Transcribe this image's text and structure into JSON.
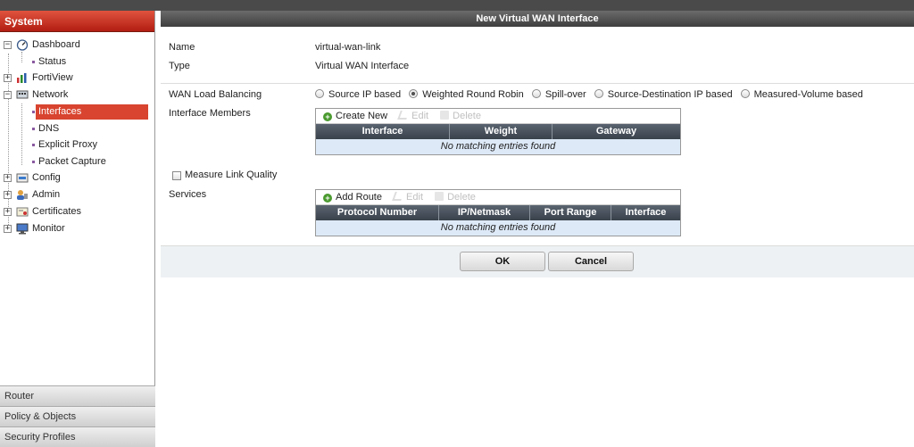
{
  "sidebar": {
    "header": "System",
    "items": [
      {
        "label": "Dashboard",
        "icon": "dashboard-icon",
        "expander": "⊟"
      },
      {
        "label": "Status"
      },
      {
        "label": "FortiView",
        "icon": "fortiview-icon",
        "expander": "⊞"
      },
      {
        "label": "Network",
        "icon": "network-icon",
        "expander": "⊟"
      },
      {
        "label": "Interfaces",
        "selected": true
      },
      {
        "label": "DNS"
      },
      {
        "label": "Explicit Proxy"
      },
      {
        "label": "Packet Capture"
      },
      {
        "label": "Config",
        "icon": "config-icon",
        "expander": "⊞"
      },
      {
        "label": "Admin",
        "icon": "admin-icon",
        "expander": "⊞"
      },
      {
        "label": "Certificates",
        "icon": "certificates-icon",
        "expander": "⊞"
      },
      {
        "label": "Monitor",
        "icon": "monitor-icon",
        "expander": "⊞"
      }
    ],
    "bottom_sections": [
      "Router",
      "Policy & Objects",
      "Security Profiles"
    ]
  },
  "panel": {
    "title": "New Virtual WAN Interface",
    "fields": {
      "name_label": "Name",
      "name_value": "virtual-wan-link",
      "type_label": "Type",
      "type_value": "Virtual WAN Interface",
      "wan_lb_label": "WAN Load Balancing",
      "members_label": "Interface Members",
      "measure_label": "Measure Link Quality",
      "services_label": "Services"
    },
    "wan_lb_options": [
      {
        "label": "Source IP based",
        "checked": false
      },
      {
        "label": "Weighted Round Robin",
        "checked": true
      },
      {
        "label": "Spill-over",
        "checked": false
      },
      {
        "label": "Source-Destination IP based",
        "checked": false
      },
      {
        "label": "Measured-Volume based",
        "checked": false
      }
    ],
    "members_grid": {
      "toolbar": {
        "create": "Create New",
        "edit": "Edit",
        "delete": "Delete"
      },
      "columns": [
        "Interface",
        "Weight",
        "Gateway"
      ],
      "empty": "No matching entries found"
    },
    "services_grid": {
      "toolbar": {
        "add": "Add Route",
        "edit": "Edit",
        "delete": "Delete"
      },
      "columns": [
        "Protocol Number",
        "IP/Netmask",
        "Port Range",
        "Interface"
      ],
      "empty": "No matching entries found"
    },
    "buttons": {
      "ok": "OK",
      "cancel": "Cancel"
    }
  },
  "colors": {
    "accent": "#d8442f",
    "header_dark": "#3e3e3e",
    "grid_header": "#39414b",
    "grid_empty_bg": "#dde9f7"
  }
}
